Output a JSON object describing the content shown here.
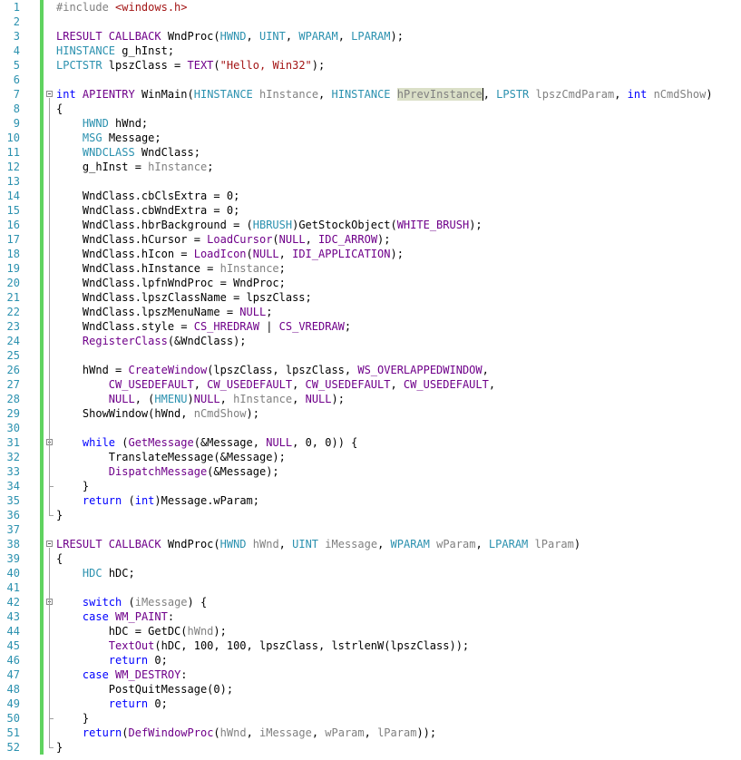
{
  "editor": {
    "lines": [
      {
        "n": "1",
        "t": [
          [
            "pp",
            "#include "
          ],
          [
            "str",
            "<windows.h>"
          ]
        ]
      },
      {
        "n": "2",
        "t": []
      },
      {
        "n": "3",
        "t": [
          [
            "macro",
            "LRESULT CALLBACK"
          ],
          [
            "plain",
            " WndProc("
          ],
          [
            "type",
            "HWND"
          ],
          [
            "plain",
            ", "
          ],
          [
            "type",
            "UINT"
          ],
          [
            "plain",
            ", "
          ],
          [
            "type",
            "WPARAM"
          ],
          [
            "plain",
            ", "
          ],
          [
            "type",
            "LPARAM"
          ],
          [
            "plain",
            ");"
          ]
        ]
      },
      {
        "n": "4",
        "t": [
          [
            "type",
            "HINSTANCE"
          ],
          [
            "plain",
            " g_hInst;"
          ]
        ]
      },
      {
        "n": "5",
        "t": [
          [
            "type",
            "LPCTSTR"
          ],
          [
            "plain",
            " lpszClass = "
          ],
          [
            "macro",
            "TEXT"
          ],
          [
            "plain",
            "("
          ],
          [
            "str",
            "\"Hello, Win32\""
          ],
          [
            "plain",
            ");"
          ]
        ]
      },
      {
        "n": "6",
        "t": []
      },
      {
        "n": "7",
        "t": [
          [
            "kw",
            "int"
          ],
          [
            "plain",
            " "
          ],
          [
            "macro",
            "APIENTRY"
          ],
          [
            "plain",
            " WinMain("
          ],
          [
            "type",
            "HINSTANCE"
          ],
          [
            "plain",
            " "
          ],
          [
            "param",
            "hInstance"
          ],
          [
            "plain",
            ", "
          ],
          [
            "type",
            "HINSTANCE"
          ],
          [
            "plain",
            " "
          ],
          [
            "hl",
            "hPrevInstance"
          ],
          [
            "caret",
            ""
          ],
          [
            "plain",
            ", "
          ],
          [
            "type",
            "LPSTR"
          ],
          [
            "plain",
            " "
          ],
          [
            "param",
            "lpszCmdParam"
          ],
          [
            "plain",
            ", "
          ],
          [
            "kw",
            "int"
          ],
          [
            "plain",
            " "
          ],
          [
            "param",
            "nCmdShow"
          ],
          [
            "plain",
            ")"
          ]
        ]
      },
      {
        "n": "8",
        "t": [
          [
            "plain",
            "{"
          ]
        ]
      },
      {
        "n": "9",
        "t": [
          [
            "plain",
            "    "
          ],
          [
            "type",
            "HWND"
          ],
          [
            "plain",
            " hWnd;"
          ]
        ]
      },
      {
        "n": "10",
        "t": [
          [
            "plain",
            "    "
          ],
          [
            "type",
            "MSG"
          ],
          [
            "plain",
            " Message;"
          ]
        ]
      },
      {
        "n": "11",
        "t": [
          [
            "plain",
            "    "
          ],
          [
            "type",
            "WNDCLASS"
          ],
          [
            "plain",
            " WndClass;"
          ]
        ]
      },
      {
        "n": "12",
        "t": [
          [
            "plain",
            "    g_hInst = "
          ],
          [
            "param",
            "hInstance"
          ],
          [
            "plain",
            ";"
          ]
        ]
      },
      {
        "n": "13",
        "t": []
      },
      {
        "n": "14",
        "t": [
          [
            "plain",
            "    WndClass.cbClsExtra = 0;"
          ]
        ]
      },
      {
        "n": "15",
        "t": [
          [
            "plain",
            "    WndClass.cbWndExtra = 0;"
          ]
        ]
      },
      {
        "n": "16",
        "t": [
          [
            "plain",
            "    WndClass.hbrBackground = ("
          ],
          [
            "type",
            "HBRUSH"
          ],
          [
            "plain",
            ")GetStockObject("
          ],
          [
            "macro",
            "WHITE_BRUSH"
          ],
          [
            "plain",
            ");"
          ]
        ]
      },
      {
        "n": "17",
        "t": [
          [
            "plain",
            "    WndClass.hCursor = "
          ],
          [
            "macro",
            "LoadCursor"
          ],
          [
            "plain",
            "("
          ],
          [
            "macro",
            "NULL"
          ],
          [
            "plain",
            ", "
          ],
          [
            "macro",
            "IDC_ARROW"
          ],
          [
            "plain",
            ");"
          ]
        ]
      },
      {
        "n": "18",
        "t": [
          [
            "plain",
            "    WndClass.hIcon = "
          ],
          [
            "macro",
            "LoadIcon"
          ],
          [
            "plain",
            "("
          ],
          [
            "macro",
            "NULL"
          ],
          [
            "plain",
            ", "
          ],
          [
            "macro",
            "IDI_APPLICATION"
          ],
          [
            "plain",
            ");"
          ]
        ]
      },
      {
        "n": "19",
        "t": [
          [
            "plain",
            "    WndClass.hInstance = "
          ],
          [
            "param",
            "hInstance"
          ],
          [
            "plain",
            ";"
          ]
        ]
      },
      {
        "n": "20",
        "t": [
          [
            "plain",
            "    WndClass.lpfnWndProc = WndProc;"
          ]
        ]
      },
      {
        "n": "21",
        "t": [
          [
            "plain",
            "    WndClass.lpszClassName = lpszClass;"
          ]
        ]
      },
      {
        "n": "22",
        "t": [
          [
            "plain",
            "    WndClass.lpszMenuName = "
          ],
          [
            "macro",
            "NULL"
          ],
          [
            "plain",
            ";"
          ]
        ]
      },
      {
        "n": "23",
        "t": [
          [
            "plain",
            "    WndClass.style = "
          ],
          [
            "macro",
            "CS_HREDRAW"
          ],
          [
            "plain",
            " | "
          ],
          [
            "macro",
            "CS_VREDRAW"
          ],
          [
            "plain",
            ";"
          ]
        ]
      },
      {
        "n": "24",
        "t": [
          [
            "plain",
            "    "
          ],
          [
            "macro",
            "RegisterClass"
          ],
          [
            "plain",
            "(&WndClass);"
          ]
        ]
      },
      {
        "n": "25",
        "t": []
      },
      {
        "n": "26",
        "t": [
          [
            "plain",
            "    hWnd = "
          ],
          [
            "macro",
            "CreateWindow"
          ],
          [
            "plain",
            "(lpszClass, lpszClass, "
          ],
          [
            "macro",
            "WS_OVERLAPPEDWINDOW"
          ],
          [
            "plain",
            ","
          ]
        ]
      },
      {
        "n": "27",
        "t": [
          [
            "plain",
            "        "
          ],
          [
            "macro",
            "CW_USEDEFAULT"
          ],
          [
            "plain",
            ", "
          ],
          [
            "macro",
            "CW_USEDEFAULT"
          ],
          [
            "plain",
            ", "
          ],
          [
            "macro",
            "CW_USEDEFAULT"
          ],
          [
            "plain",
            ", "
          ],
          [
            "macro",
            "CW_USEDEFAULT"
          ],
          [
            "plain",
            ","
          ]
        ]
      },
      {
        "n": "28",
        "t": [
          [
            "plain",
            "        "
          ],
          [
            "macro",
            "NULL"
          ],
          [
            "plain",
            ", ("
          ],
          [
            "type",
            "HMENU"
          ],
          [
            "plain",
            ")"
          ],
          [
            "macro",
            "NULL"
          ],
          [
            "plain",
            ", "
          ],
          [
            "param",
            "hInstance"
          ],
          [
            "plain",
            ", "
          ],
          [
            "macro",
            "NULL"
          ],
          [
            "plain",
            ");"
          ]
        ]
      },
      {
        "n": "29",
        "t": [
          [
            "plain",
            "    ShowWindow(hWnd, "
          ],
          [
            "param",
            "nCmdShow"
          ],
          [
            "plain",
            ");"
          ]
        ]
      },
      {
        "n": "30",
        "t": []
      },
      {
        "n": "31",
        "t": [
          [
            "plain",
            "    "
          ],
          [
            "kw",
            "while"
          ],
          [
            "plain",
            " ("
          ],
          [
            "macro",
            "GetMessage"
          ],
          [
            "plain",
            "(&Message, "
          ],
          [
            "macro",
            "NULL"
          ],
          [
            "plain",
            ", 0, 0)) {"
          ]
        ]
      },
      {
        "n": "32",
        "t": [
          [
            "plain",
            "        TranslateMessage(&Message);"
          ]
        ]
      },
      {
        "n": "33",
        "t": [
          [
            "plain",
            "        "
          ],
          [
            "macro",
            "DispatchMessage"
          ],
          [
            "plain",
            "(&Message);"
          ]
        ]
      },
      {
        "n": "34",
        "t": [
          [
            "plain",
            "    }"
          ]
        ]
      },
      {
        "n": "35",
        "t": [
          [
            "plain",
            "    "
          ],
          [
            "kw",
            "return"
          ],
          [
            "plain",
            " ("
          ],
          [
            "kw",
            "int"
          ],
          [
            "plain",
            ")Message.wParam;"
          ]
        ]
      },
      {
        "n": "36",
        "t": [
          [
            "plain",
            "}"
          ]
        ]
      },
      {
        "n": "37",
        "t": []
      },
      {
        "n": "38",
        "t": [
          [
            "macro",
            "LRESULT CALLBACK"
          ],
          [
            "plain",
            " WndProc("
          ],
          [
            "type",
            "HWND"
          ],
          [
            "plain",
            " "
          ],
          [
            "param",
            "hWnd"
          ],
          [
            "plain",
            ", "
          ],
          [
            "type",
            "UINT"
          ],
          [
            "plain",
            " "
          ],
          [
            "param",
            "iMessage"
          ],
          [
            "plain",
            ", "
          ],
          [
            "type",
            "WPARAM"
          ],
          [
            "plain",
            " "
          ],
          [
            "param",
            "wParam"
          ],
          [
            "plain",
            ", "
          ],
          [
            "type",
            "LPARAM"
          ],
          [
            "plain",
            " "
          ],
          [
            "param",
            "lParam"
          ],
          [
            "plain",
            ")"
          ]
        ]
      },
      {
        "n": "39",
        "t": [
          [
            "plain",
            "{"
          ]
        ]
      },
      {
        "n": "40",
        "t": [
          [
            "plain",
            "    "
          ],
          [
            "type",
            "HDC"
          ],
          [
            "plain",
            " hDC;"
          ]
        ]
      },
      {
        "n": "41",
        "t": []
      },
      {
        "n": "42",
        "t": [
          [
            "plain",
            "    "
          ],
          [
            "kw",
            "switch"
          ],
          [
            "plain",
            " ("
          ],
          [
            "param",
            "iMessage"
          ],
          [
            "plain",
            ") {"
          ]
        ]
      },
      {
        "n": "43",
        "t": [
          [
            "plain",
            "    "
          ],
          [
            "kw",
            "case"
          ],
          [
            "plain",
            " "
          ],
          [
            "macro",
            "WM_PAINT"
          ],
          [
            "plain",
            ":"
          ]
        ]
      },
      {
        "n": "44",
        "t": [
          [
            "plain",
            "        hDC = GetDC("
          ],
          [
            "param",
            "hWnd"
          ],
          [
            "plain",
            ");"
          ]
        ]
      },
      {
        "n": "45",
        "t": [
          [
            "plain",
            "        "
          ],
          [
            "macro",
            "TextOut"
          ],
          [
            "plain",
            "(hDC, 100, 100, lpszClass, lstrlenW(lpszClass));"
          ]
        ]
      },
      {
        "n": "46",
        "t": [
          [
            "plain",
            "        "
          ],
          [
            "kw",
            "return"
          ],
          [
            "plain",
            " 0;"
          ]
        ]
      },
      {
        "n": "47",
        "t": [
          [
            "plain",
            "    "
          ],
          [
            "kw",
            "case"
          ],
          [
            "plain",
            " "
          ],
          [
            "macro",
            "WM_DESTROY"
          ],
          [
            "plain",
            ":"
          ]
        ]
      },
      {
        "n": "48",
        "t": [
          [
            "plain",
            "        PostQuitMessage(0);"
          ]
        ]
      },
      {
        "n": "49",
        "t": [
          [
            "plain",
            "        "
          ],
          [
            "kw",
            "return"
          ],
          [
            "plain",
            " 0;"
          ]
        ]
      },
      {
        "n": "50",
        "t": [
          [
            "plain",
            "    }"
          ]
        ]
      },
      {
        "n": "51",
        "t": [
          [
            "plain",
            "    "
          ],
          [
            "kw",
            "return"
          ],
          [
            "plain",
            "("
          ],
          [
            "macro",
            "DefWindowProc"
          ],
          [
            "plain",
            "("
          ],
          [
            "param",
            "hWnd"
          ],
          [
            "plain",
            ", "
          ],
          [
            "param",
            "iMessage"
          ],
          [
            "plain",
            ", "
          ],
          [
            "param",
            "wParam"
          ],
          [
            "plain",
            ", "
          ],
          [
            "param",
            "lParam"
          ],
          [
            "plain",
            "));"
          ]
        ]
      },
      {
        "n": "52",
        "t": [
          [
            "plain",
            "}"
          ]
        ]
      }
    ],
    "colors": {
      "line_numbers": "#2b91af",
      "keyword": "#0000ff",
      "type": "#2b91af",
      "macro": "#6f008a",
      "string": "#a31515",
      "parameter": "#808080",
      "change_bar": "#5fd35f",
      "highlight": "#dbe0c8"
    }
  }
}
